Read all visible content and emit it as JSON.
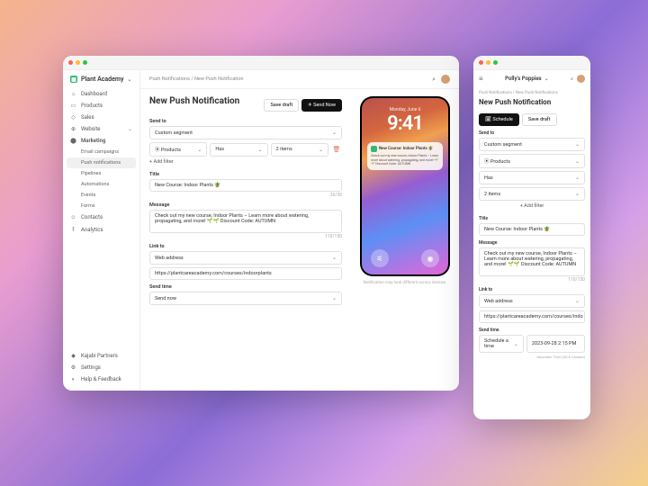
{
  "w1": {
    "brand": "Plant Academy",
    "nav": {
      "dashboard": "Dashboard",
      "products": "Products",
      "sales": "Sales",
      "website": "Website",
      "marketing": "Marketing",
      "marketing_sub": {
        "email": "Email campaigns",
        "push": "Push notifications",
        "pipelines": "Pipelines",
        "automations": "Automations",
        "events": "Events",
        "forms": "Forms"
      },
      "contacts": "Contacts",
      "analytics": "Analytics",
      "partners": "Kajabi Partners",
      "settings": "Settings",
      "help": "Help & Feedback"
    },
    "crumbs": "Push Notifications   /   New Push Notification",
    "page_title": "New Push Notification",
    "buttons": {
      "save_draft": "Save draft",
      "send_now": "✈ Send Now"
    },
    "form": {
      "send_to": "Send to",
      "segment": "Custom segment",
      "filter": {
        "a": "⦿ Products",
        "b": "Has",
        "c": "2 items"
      },
      "add_filter": "+  Add filter",
      "title_lbl": "Title",
      "title_val": "New Course: Indoor Plants 🪴",
      "title_count": "26/30",
      "msg_lbl": "Message",
      "msg_val": "Check out my new course, Indoor Plants – Learn more about watering, propagating, and more! 🌱🌱 Discount Code: AUTUMN",
      "msg_count": "110/150",
      "link_lbl": "Link to",
      "link_type": "Web address",
      "link_url": "https://plantcareacademy.com/courses/indoorplants",
      "send_time_lbl": "Send time",
      "send_time": "Send now"
    },
    "preview": {
      "date": "Monday, June 6",
      "time": "9:41",
      "notif_title": "New Course: Indoor Plants 🪴",
      "notif_body": "Check out my new course, Indoor Plants – Learn more about watering, propagating, and more! 🌱🌱 Discount Code: AUTUMN",
      "caption": "Notification may look different across devices."
    }
  },
  "w2": {
    "brand": "Polly's Poppies",
    "crumbs": "Push Notifications / New Push Notifications",
    "page_title": "New Push Notification",
    "buttons": {
      "schedule": "🗓 Schedule",
      "save_draft": "Save draft"
    },
    "form": {
      "send_to": "Send to",
      "segment": "Custom segment",
      "products": "⦿ Products",
      "has": "Has",
      "items": "2 items",
      "add_filter": "+  Add filter",
      "title_lbl": "Title",
      "title_val": "New Course: Indoor Plants 🪴",
      "msg_lbl": "Message",
      "msg_val": "Check out my new course, Indoor Plants – Learn more about watering, propagating, and more! 🌱🌱 Discount Code: AUTUMN",
      "msg_count": "110/150",
      "link_lbl": "Link to",
      "link_type": "Web address",
      "link_url": "https://plantcareacademy.com/courses/indo",
      "send_time_lbl": "Send time",
      "send_time_a": "Schedule a time",
      "send_time_b": "2023-09-28 2:15 PM",
      "tz": "Mountain Time (US & Canada)"
    }
  }
}
